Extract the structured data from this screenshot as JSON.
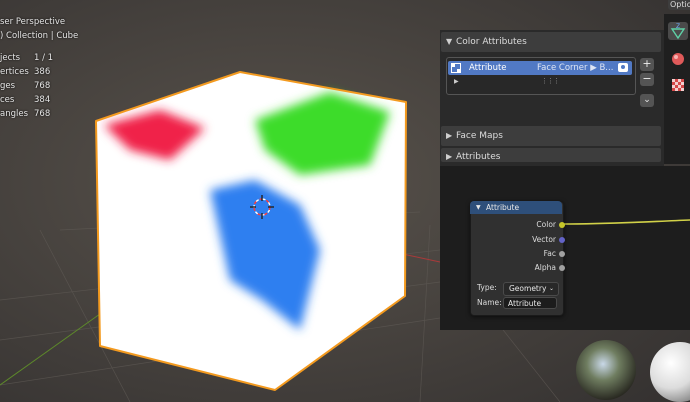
{
  "viewport": {
    "view_title": "ser Perspective",
    "collection_label": ") Collection | Cube",
    "stats": [
      {
        "label": "jects",
        "value": "1 / 1"
      },
      {
        "label": "ertices",
        "value": "386"
      },
      {
        "label": "ges",
        "value": "768"
      },
      {
        "label": "ces",
        "value": "384"
      },
      {
        "label": "angles",
        "value": "768"
      }
    ],
    "options_label": "Optio"
  },
  "properties": {
    "sections": {
      "color_attributes": "Color Attributes",
      "face_maps": "Face Maps",
      "attributes": "Attributes"
    },
    "color_attribute_list": [
      {
        "name": "Attribute",
        "domain": "Face Corner ▶ B..."
      }
    ],
    "list_buttons": {
      "add": "+",
      "remove": "−",
      "more": "⌄"
    }
  },
  "node": {
    "title": "Attribute",
    "outputs": [
      "Color",
      "Vector",
      "Fac",
      "Alpha"
    ],
    "type_label": "Type:",
    "type_value": "Geometry",
    "name_label": "Name:",
    "name_value": "Attribute"
  },
  "colors": {
    "selection_outline": "#f39a1f",
    "active_item": "#5179c4",
    "node_header": "#2e4f7a",
    "socket_color": "#c7c729",
    "socket_vector": "#6363c7",
    "socket_float": "#a1a1a1"
  },
  "icons": [
    "vertex-color-icon",
    "camera-icon",
    "z-axis-icon",
    "object-data-icon",
    "material-icon",
    "texture-icon",
    "chevron-down-icon",
    "grip-icon"
  ]
}
